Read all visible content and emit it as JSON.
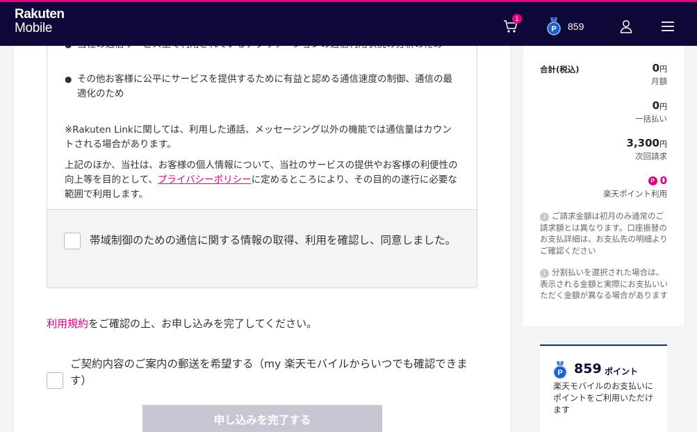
{
  "header": {
    "logo_line1": "Rakuten",
    "logo_line2": "Mobile",
    "cart_count": "1",
    "points": "859"
  },
  "consent": {
    "bullet_partial": "当社の通信サービス上で利用されているアプリケーションの通信利用状況の分析のため",
    "bullet_2": "その他お客様に公平にサービスを提供するために有益と認める通信速度の制御、通信の最適化のため",
    "note": "※Rakuten Linkに関しては、利用した通話、メッセージング以外の機能では通信量はカウントされる場合があります。",
    "privacy_pre": "上記のほか、当社は、お客様の個人情報について、当社のサービスの提供やお客様の利便性の向上等を目的として、",
    "privacy_link": "プライバシーポリシー",
    "privacy_post": "に定めるところにより、その目的の遂行に必要な範囲で利用します。",
    "checkbox_label": "帯域制御のための通信に関する情報の取得、利用を確認し、同意しました。"
  },
  "terms": {
    "link": "利用規約",
    "text": "をご確認の上、お申し込みを完了してください。"
  },
  "mail_option": {
    "label": "ご契約内容のご案内の郵送を希望する（my 楽天モバイルからいつでも確認できます）"
  },
  "submit": {
    "label": "申し込みを完了する"
  },
  "summary": {
    "total_label": "合計(税込)",
    "monthly_value": "0",
    "monthly_unit": "円",
    "monthly_label": "月額",
    "lump_value": "0",
    "lump_unit": "円",
    "lump_label": "一括払い",
    "next_value": "3,300",
    "next_unit": "円",
    "next_label": "次回請求",
    "points_used_value": "0",
    "points_used_label": "楽天ポイント利用",
    "info1": "ご請求金額は初月のみ通常のご請求額とは異なります。口座振替のお支払詳細は、お支払先の明細よりご確認ください",
    "info2": "分割払いを選択された場合は、表示される金額と実際にお支払いいただく金額が異なる場合があります"
  },
  "points_card": {
    "value": "859",
    "unit": "ポイント",
    "desc": "楽天モバイルのお支払いにポイントをご利用いただけます"
  },
  "colors": {
    "header_bg": "#0d0838",
    "accent": "#e5007e",
    "button_disabled": "#c7c7d4"
  }
}
